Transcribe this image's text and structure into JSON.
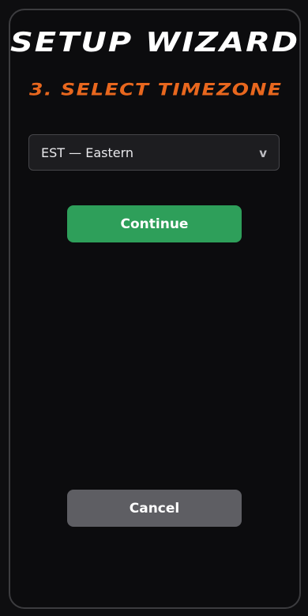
{
  "header": {
    "title": "Setup Wizard",
    "step_title": "3. Select Timezone"
  },
  "timezone_select": {
    "selected_value": "EST — Eastern",
    "chevron_glyph": "v",
    "chevron_icon": "chevron-down-icon"
  },
  "actions": {
    "continue_label": "Continue",
    "cancel_label": "Cancel"
  },
  "colors": {
    "background": "#0c0c0e",
    "step_title": "#e8671e",
    "continue_button": "#2e9f5a",
    "cancel_button": "#5e5e63"
  }
}
